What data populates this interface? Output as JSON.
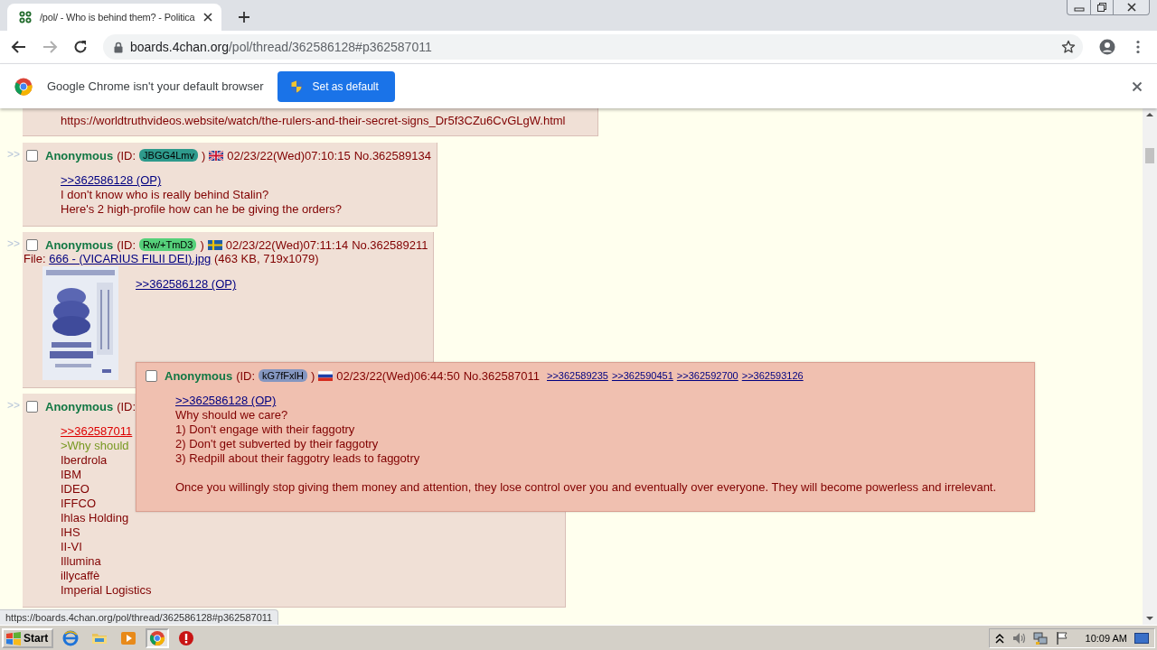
{
  "browser": {
    "tab_title": "/pol/ - Who is behind them? - Politica",
    "url_host": "boards.4chan.org",
    "url_path": "/pol/thread/362586128#p362587011"
  },
  "infobar": {
    "message": "Google Chrome isn't your default browser",
    "button": "Set as default"
  },
  "posts": [
    {
      "kind": "tail",
      "lines": [
        {
          "kind": "text",
          "text": "https://worldtruthvideos.website/watch/the-rulers-and-their-secret-signs_Dr5f3CZu6CvGLgW.html"
        }
      ]
    },
    {
      "kind": "reply",
      "marker": ">>",
      "checked": false,
      "name": "Anonymous",
      "id_label": "(ID:",
      "id": "JBGG4Lmv",
      "color": "#2e9a8c",
      "id_close": ")",
      "flag": {
        "kind": "gb"
      },
      "datetime": "02/23/22(Wed)07:10:15",
      "number": "No.362589134",
      "lines": [
        {
          "kind": "quotelink",
          "text": ">>362586128 (OP)"
        },
        {
          "kind": "text",
          "text": "I don't know who is really behind Stalin?"
        },
        {
          "kind": "text",
          "text": "Here's 2 high-profile how can he be giving the orders?"
        }
      ]
    },
    {
      "kind": "reply",
      "marker": ">>",
      "checked": false,
      "name": "Anonymous",
      "id_label": "(ID:",
      "id": "Rw/+TmD3",
      "color": "#55d07a",
      "id_close": ")",
      "flag": {
        "kind": "se"
      },
      "datetime": "02/23/22(Wed)07:11:14",
      "number": "No.362589211",
      "file": {
        "label": "File:",
        "link": "666 - (VICARIUS FILII DEI).jpg",
        "info": "(463 KB, 719x1079)"
      },
      "lines": [
        {
          "kind": "quotelink",
          "text": ">>362586128 (OP)"
        }
      ]
    },
    {
      "kind": "reply",
      "marker": ">>",
      "checked": false,
      "name": "Anonymous",
      "id_label": "(ID:",
      "lines": [
        {
          "kind": "hoveredlink",
          "text": ">>362587011"
        },
        {
          "kind": "greentext",
          "text": ">Why should"
        },
        {
          "kind": "text",
          "text": "Iberdrola"
        },
        {
          "kind": "text",
          "text": "IBM"
        },
        {
          "kind": "text",
          "text": "IDEO"
        },
        {
          "kind": "text",
          "text": "IFFCO"
        },
        {
          "kind": "text",
          "text": "Ihlas Holding"
        },
        {
          "kind": "text",
          "text": "IHS"
        },
        {
          "kind": "text",
          "text": "II-VI"
        },
        {
          "kind": "text",
          "text": "Illumina"
        },
        {
          "kind": "text",
          "text": "illycaffè"
        },
        {
          "kind": "text",
          "text": "Imperial Logistics"
        }
      ]
    }
  ],
  "hover_post": {
    "checked": false,
    "name": "Anonymous",
    "id_label": "(ID:",
    "id": "kG7fFxlH",
    "color": "#8496c0",
    "id_close": ")",
    "flag": {
      "kind": "ru"
    },
    "datetime": "02/23/22(Wed)06:44:50",
    "number": "No.362587011",
    "backlinks": [
      ">>362589235",
      ">>362590451",
      ">>362592700",
      ">>362593126"
    ],
    "lines": [
      {
        "kind": "quotelink",
        "text": ">>362586128 (OP)"
      },
      {
        "kind": "text",
        "text": "Why should we care?"
      },
      {
        "kind": "text",
        "text": "1) Don't engage with their faggotry"
      },
      {
        "kind": "text",
        "text": "2) Don't get subverted by their faggotry"
      },
      {
        "kind": "text",
        "text": "3) Redpill about their faggotry leads to faggotry"
      },
      {
        "kind": "blank"
      },
      {
        "kind": "text",
        "text": "Once you willingly stop giving them money and attention, they lose control over you and eventually over everyone. They will become powerless and irrelevant."
      }
    ]
  },
  "status_url": "https://boards.4chan.org/pol/thread/362586128#p362587011",
  "taskbar": {
    "start": "Start",
    "clock": "10:09 AM"
  }
}
